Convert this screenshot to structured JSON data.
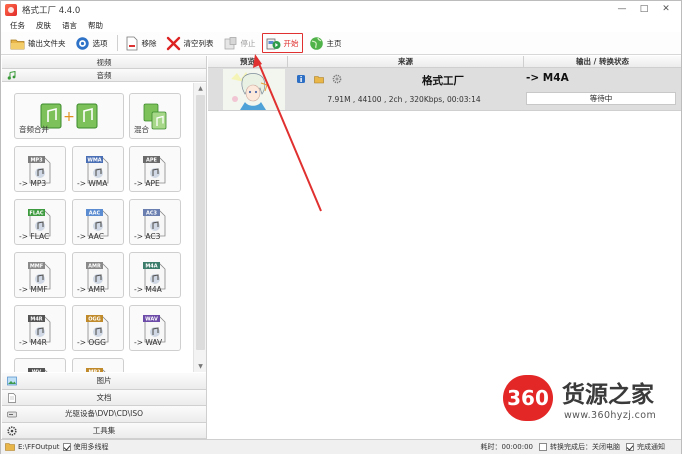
{
  "window": {
    "title": "格式工厂 4.4.0",
    "controls": [
      "—",
      "□",
      "✕"
    ]
  },
  "menu": [
    "任务",
    "皮肤",
    "语言",
    "帮助"
  ],
  "toolbar": {
    "output_folder": "输出文件夹",
    "options": "选项",
    "remove": "移除",
    "clear_list": "清空列表",
    "stop": "停止",
    "start": "开始",
    "home": "主页"
  },
  "categories": {
    "video": "视频",
    "audio": "音频"
  },
  "tiles": [
    {
      "label": "音频合并",
      "badge": ""
    },
    {
      "label": "混合",
      "badge": ""
    },
    {
      "label": "-> MP3",
      "badge": "MP3",
      "color": "#7d7d7d"
    },
    {
      "label": "-> WMA",
      "badge": "WMA",
      "color": "#4a6fb5"
    },
    {
      "label": "-> APE",
      "badge": "APE",
      "color": "#6a6a6a"
    },
    {
      "label": "-> FLAC",
      "badge": "FLAC",
      "color": "#3e9a3e"
    },
    {
      "label": "-> AAC",
      "badge": "AAC",
      "color": "#5b8bd0"
    },
    {
      "label": "-> AC3",
      "badge": "AC3",
      "color": "#6a7fb0"
    },
    {
      "label": "-> MMF",
      "badge": "MMF",
      "color": "#8a8a8a"
    },
    {
      "label": "-> AMR",
      "badge": "AMR",
      "color": "#8a8a8a"
    },
    {
      "label": "-> M4A",
      "badge": "M4A",
      "color": "#3d7d6b"
    },
    {
      "label": "-> M4R",
      "badge": "M4R",
      "color": "#555555"
    },
    {
      "label": "-> OGG",
      "badge": "OGG",
      "color": "#c08a2a"
    },
    {
      "label": "-> WAV",
      "badge": "WAV",
      "color": "#6b4aa8"
    },
    {
      "label": "",
      "badge": "WV",
      "color": "#555555"
    },
    {
      "label": "",
      "badge": "MP2",
      "color": "#c08a2a"
    }
  ],
  "bottom_categories": [
    "图片",
    "文档",
    "光驱设备\\DVD\\CD\\ISO",
    "工具集"
  ],
  "table": {
    "headers": {
      "preview": "预览",
      "source": "来源",
      "output": "输出 / 转换状态"
    },
    "row": {
      "filename": "格式工厂",
      "info": "7.91M , 44100 , 2ch , 320Kbps, 00:03:14",
      "output_format": "-> M4A",
      "status": "等待中"
    }
  },
  "statusbar": {
    "output_path": "E:\\FFOutput",
    "multithread": "使用多线程",
    "elapsed": "耗时：00:00:00",
    "after_convert": "转换完成后：关闭电脑",
    "notify": "完成通知"
  },
  "watermark": {
    "badge": "360",
    "title": "货源之家",
    "url": "www.360hyzj.com"
  },
  "colors": {
    "highlight_red": "#e0302f",
    "row_gray": "#dedede",
    "watermark_red": "#e32626"
  }
}
